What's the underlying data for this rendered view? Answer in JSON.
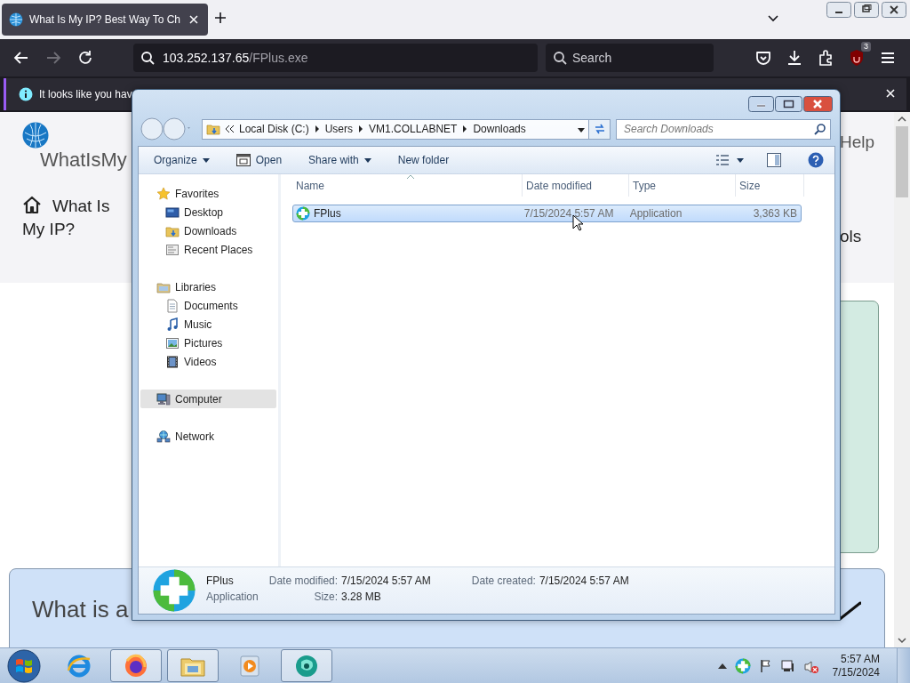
{
  "browser": {
    "tabs": [
      {
        "title": "What Is My IP? Best Way To Ch",
        "selected": true
      }
    ],
    "nav_buttons": [
      {
        "kind": "back",
        "disabled": false
      },
      {
        "kind": "forward",
        "disabled": true
      },
      {
        "kind": "reload",
        "disabled": false
      }
    ],
    "address": {
      "host": "103.252.137.65",
      "path": "/FPlus.exe"
    },
    "search": {
      "placeholder": "Search"
    },
    "toolbar_icons": [
      {
        "kind": "pocket"
      },
      {
        "kind": "download"
      },
      {
        "kind": "extensions"
      },
      {
        "kind": "ublock",
        "badge": "3"
      },
      {
        "kind": "menu"
      }
    ],
    "notification": {
      "text": "It looks like you hav"
    }
  },
  "webpage": {
    "site_name": "WhatIsMy",
    "nav_link": "What Is My IP?",
    "help_link": "Help",
    "tools_link": "ols",
    "heading": "What is a"
  },
  "explorer": {
    "breadcrumbs": [
      "Local Disk (C:)",
      "Users",
      "VM1.COLLABNET",
      "Downloads"
    ],
    "search": {
      "placeholder": "Search Downloads"
    },
    "commands": [
      {
        "label": "Organize",
        "kind": "menu"
      },
      {
        "label": "Open",
        "kind": "open"
      },
      {
        "label": "Share with",
        "kind": "menu"
      },
      {
        "label": "New folder",
        "kind": "plain"
      }
    ],
    "nav": [
      {
        "label": "Favorites",
        "kind": "star",
        "selected": false,
        "children": [
          {
            "label": "Desktop",
            "kind": "desktop",
            "selected": false
          },
          {
            "label": "Downloads",
            "kind": "folder",
            "selected": false
          },
          {
            "label": "Recent Places",
            "kind": "recent",
            "selected": false
          }
        ]
      },
      {
        "label": "Libraries",
        "kind": "library",
        "selected": false,
        "children": [
          {
            "label": "Documents",
            "kind": "document",
            "selected": false
          },
          {
            "label": "Music",
            "kind": "music",
            "selected": false
          },
          {
            "label": "Pictures",
            "kind": "picture",
            "selected": false
          },
          {
            "label": "Videos",
            "kind": "video",
            "selected": false
          }
        ]
      },
      {
        "label": "Computer",
        "kind": "computer",
        "selected": true
      },
      {
        "label": "Network",
        "kind": "network",
        "selected": false
      }
    ],
    "columns": [
      {
        "label": "Name",
        "sorted": true
      },
      {
        "label": "Date modified",
        "sorted": false
      },
      {
        "label": "Type",
        "sorted": false
      },
      {
        "label": "Size",
        "sorted": false
      }
    ],
    "files": [
      {
        "name": "FPlus",
        "date_modified": "7/15/2024 5:57 AM",
        "type": "Application",
        "size": "3,363 KB",
        "selected": true
      }
    ],
    "details": {
      "name": "FPlus",
      "type": "Application",
      "fields": [
        {
          "label": "Date modified:",
          "value": "7/15/2024 5:57 AM"
        },
        {
          "label": "Size:",
          "value": "3.28 MB"
        },
        {
          "label": "Date created:",
          "value": "7/15/2024 5:57 AM"
        }
      ]
    }
  },
  "taskbar": {
    "apps": [
      {
        "kind": "ie",
        "open": false
      },
      {
        "kind": "firefox",
        "open": true
      },
      {
        "kind": "explorer",
        "open": true
      },
      {
        "kind": "media",
        "open": false
      },
      {
        "kind": "app",
        "open": true
      }
    ],
    "volume": {
      "muted": true
    },
    "clock": {
      "time": "5:57 AM",
      "date": "7/15/2024"
    }
  }
}
